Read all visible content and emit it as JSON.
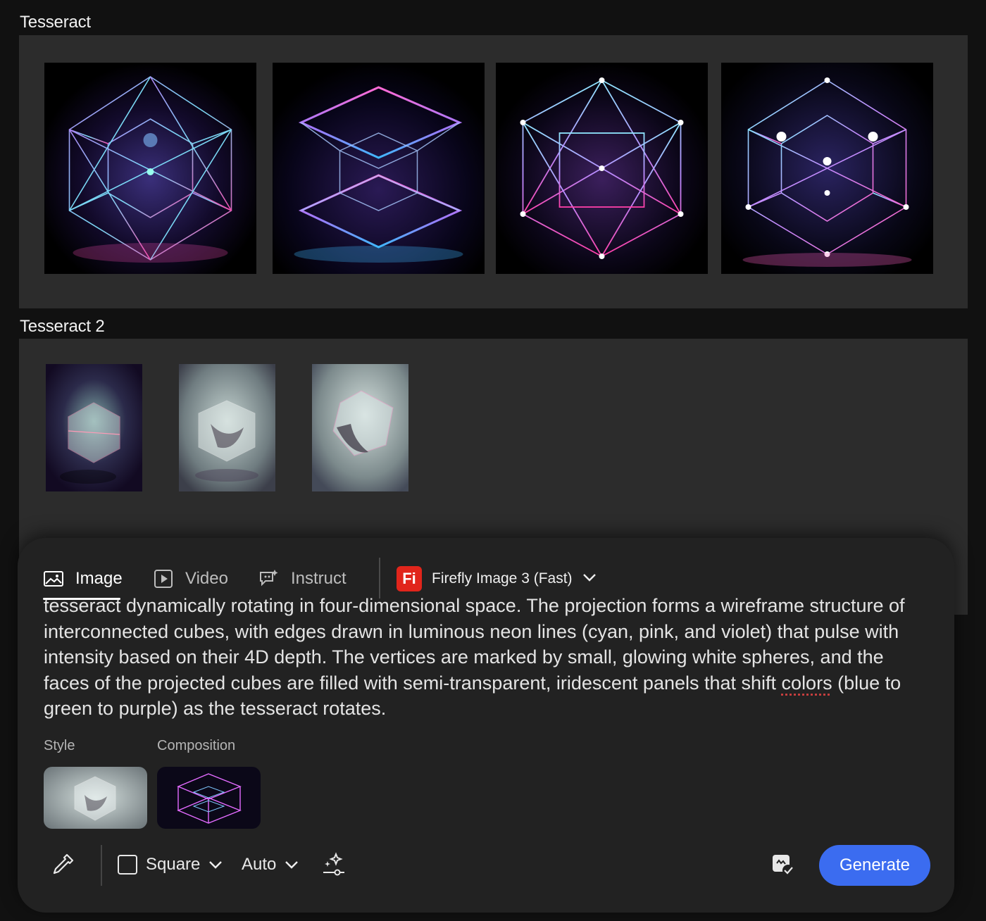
{
  "sections": [
    {
      "title": "Tesseract",
      "image_count": 4
    },
    {
      "title": "Tesseract 2",
      "image_count": 3
    }
  ],
  "panel": {
    "tabs": [
      {
        "label": "Image",
        "icon": "image-icon",
        "active": true
      },
      {
        "label": "Video",
        "icon": "video-icon",
        "active": false
      },
      {
        "label": "Instruct",
        "icon": "instruct-icon",
        "active": false
      }
    ],
    "model": {
      "badge": "Fi",
      "name": "Firefly Image 3 (Fast)",
      "icon": "chevron-down-icon"
    },
    "prompt_before": "tesseract dynamically rotating in four-dimensional space. The projection forms a wireframe structure of interconnected cubes, with edges drawn in luminous neon lines (cyan, pink, and violet) that pulse with intensity based on their 4D depth. The vertices are marked by small, glowing white spheres, and the faces of the projected cubes are filled with semi-transparent, iridescent panels that shift ",
    "prompt_spell": "colors",
    "prompt_after": " (blue to green to purple) as the tesseract rotates.",
    "style_label": "Style",
    "composition_label": "Composition",
    "toolbar": {
      "eyedropper_icon": "eyedropper-icon",
      "aspect_label": "Square",
      "content_label": "Auto",
      "effects_icon": "sparkle-settings-icon",
      "credits_icon": "image-check-icon",
      "generate_label": "Generate"
    }
  },
  "colors": {
    "background": "#111111",
    "board": "#2c2c2c",
    "panel": "#222222",
    "accent": "#3b6cf0",
    "badge": "#e1251b"
  }
}
